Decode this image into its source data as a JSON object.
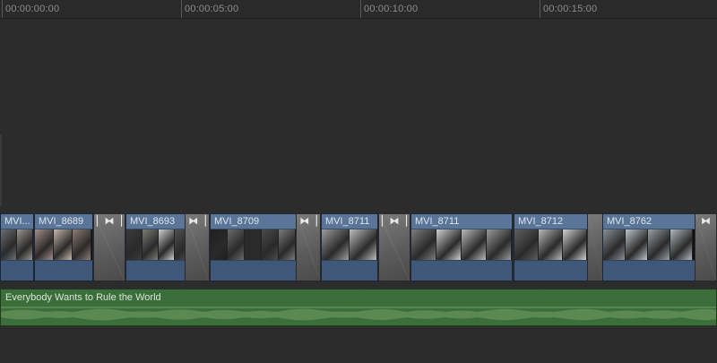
{
  "ruler": {
    "labels": [
      "00:00:00:00",
      "00:00:05:00",
      "00:00:10:00",
      "00:00:15:00"
    ]
  },
  "video_track": {
    "clips": [
      {
        "title": "MVI...",
        "frames": [
          "#6b6f73",
          "#9a9690"
        ]
      },
      {
        "title": "MVI_8689",
        "frames": [
          "#a38f8a",
          "#c8b7ad",
          "#8f7c74"
        ]
      },
      {
        "title": "MVI_8693",
        "frames": [
          "#3a3a3a",
          "#7b7c78",
          "#cfcfcf",
          "#505050"
        ]
      },
      {
        "title": "MVI_8709",
        "frames": [
          "#1f1f1f",
          "#6a6a6a",
          "#2a2a2a",
          "#4a4a4a",
          "#7a7a7a"
        ]
      },
      {
        "title": "MVI_8711",
        "frames": [
          "#9b9b9b",
          "#bdbdbd"
        ]
      },
      {
        "title": "MVI_8711",
        "frames": [
          "#7d7d7d",
          "#cfcfcf",
          "#bababa",
          "#9a9a9a"
        ]
      },
      {
        "title": "MVI_8712",
        "frames": [
          "#5f5f5f",
          "#b9b9b9",
          "#d1d1d1"
        ]
      },
      {
        "title": "MVI_8762",
        "frames": [
          "#8a8f96",
          "#c0c4c8",
          "#9aa0a6",
          "#b4b8bc"
        ]
      }
    ],
    "transition_icon": "transition-icon"
  },
  "music": {
    "title": "Everybody Wants to Rule the World"
  },
  "colors": {
    "background": "#2c2c2c",
    "video_clip": "#4d6687",
    "audio_clip": "#3b6e3b",
    "transition": "#6a6a6a"
  }
}
